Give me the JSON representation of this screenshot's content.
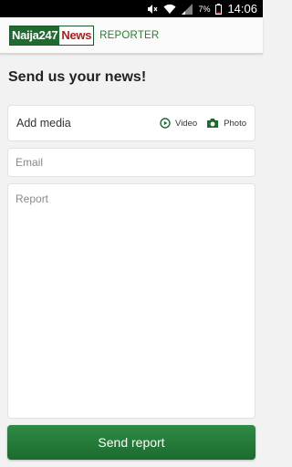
{
  "status_bar": {
    "battery_percent": "7%",
    "time": "14:06",
    "icons": [
      "mute-icon",
      "wifi-icon",
      "signal-icon",
      "battery-icon"
    ]
  },
  "app_bar": {
    "logo_left": "Naija247",
    "logo_right": "News",
    "subtitle": "REPORTER"
  },
  "heading": "Send us your news!",
  "media": {
    "label": "Add media",
    "video_label": "Video",
    "photo_label": "Photo"
  },
  "email": {
    "placeholder": "Email",
    "value": ""
  },
  "report": {
    "placeholder": "Report",
    "value": ""
  },
  "send_button": "Send report",
  "colors": {
    "brand_green": "#1f6b2f",
    "brand_red": "#b31b1b",
    "accent_green": "#2e7d32"
  }
}
